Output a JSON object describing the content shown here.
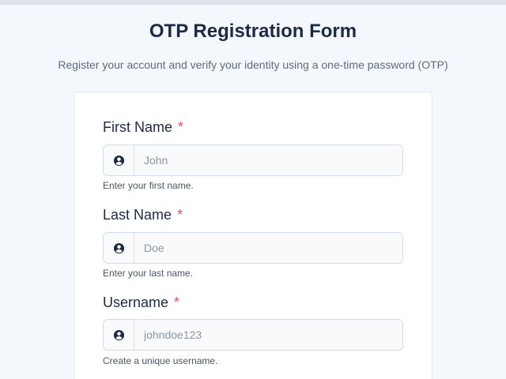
{
  "header": {
    "title": "OTP Registration Form",
    "subtitle": "Register your account and verify your identity using a one-time password (OTP)"
  },
  "form": {
    "required_marker": "*",
    "first_name": {
      "label": "First Name",
      "placeholder": "John",
      "value": "",
      "help": "Enter your first name.",
      "icon": "user-circle-icon"
    },
    "last_name": {
      "label": "Last Name",
      "placeholder": "Doe",
      "value": "",
      "help": "Enter your last name.",
      "icon": "user-circle-icon"
    },
    "username": {
      "label": "Username",
      "placeholder": "johndoe123",
      "value": "",
      "help": "Create a unique username.",
      "icon": "user-circle-icon"
    }
  },
  "colors": {
    "background": "#f4f7fb",
    "title": "#1e2a44",
    "required": "#e05656",
    "input_border": "#d6dde6"
  }
}
